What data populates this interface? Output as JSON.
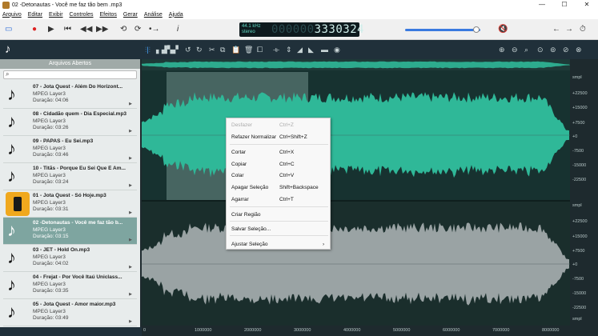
{
  "window": {
    "title": "02 -Detonautas - Você me faz tão bem .mp3",
    "min": "—",
    "max": "☐",
    "close": "✕"
  },
  "menu": [
    "Arquivo",
    "Editar",
    "Exibir",
    "Controles",
    "Efeitos",
    "Gerar",
    "Análise",
    "Ajuda"
  ],
  "display": {
    "khz": "44.1 kHz",
    "stereo": "stereo",
    "counter_dim": "000000",
    "counter_value": "3330324"
  },
  "volume": {
    "level": 0.95
  },
  "sidebar": {
    "header": "Arquivos Abertos",
    "search_placeholder": "",
    "items": [
      {
        "title": "07 - Jota Quest - Além Do Horizont...",
        "format": "MPEG Layer3",
        "duration": "Duração: 04:06",
        "icon": "music-note-icon"
      },
      {
        "title": "08 - Cidadão quem - Dia Especial.mp3",
        "format": "MPEG Layer3",
        "duration": "Duração: 03:26",
        "icon": "music-note-icon"
      },
      {
        "title": "09 - PAPAS - Eu Sei.mp3",
        "format": "MPEG Layer3",
        "duration": "Duração: 03:46",
        "icon": "music-note-icon"
      },
      {
        "title": "10 - Titãs - Porque Eu Sei Que É Am...",
        "format": "MPEG Layer3",
        "duration": "Duração: 03:24",
        "icon": "music-note-icon"
      },
      {
        "title": "01 - Jota Quest - Só Hoje.mp3",
        "format": "MPEG Layer3",
        "duration": "Duração: 03:31",
        "icon": "app-icon"
      },
      {
        "title": "02 -Detonautas - Você me faz tão b...",
        "format": "MPEG Layer3",
        "duration": "Duração: 03:15",
        "icon": "music-note-icon",
        "selected": true
      },
      {
        "title": "03 - JET - Hold On.mp3",
        "format": "MPEG Layer3",
        "duration": "Duração: 04:02",
        "icon": "music-note-icon"
      },
      {
        "title": "04 - Frejat - Por Você Itaú Uniclass...",
        "format": "MPEG Layer3",
        "duration": "Duração: 03:35",
        "icon": "music-note-icon"
      },
      {
        "title": "05 - Jota Quest - Amor maior.mp3",
        "format": "MPEG Layer3",
        "duration": "Duração: 03:49",
        "icon": "music-note-icon"
      }
    ]
  },
  "ruler": {
    "top": [
      "smpl",
      "+22500",
      "+15000",
      "+7500",
      "+0",
      "-7500",
      "-15000",
      "-22500"
    ],
    "bottom": [
      "smpl",
      "+22500",
      "+15000",
      "+7500",
      "+0",
      "-7500",
      "-15000",
      "-22500",
      "smpl"
    ]
  },
  "timeline": [
    "0",
    "1000000",
    "2000000",
    "3000000",
    "4000000",
    "5000000",
    "6000000",
    "7000000",
    "8000000"
  ],
  "context_menu": {
    "items": [
      {
        "label": "Desfazer",
        "shortcut": "Ctrl+Z",
        "disabled": true
      },
      {
        "label": "Refazer Normalizar",
        "shortcut": "Ctrl+Shift+Z"
      },
      {
        "label": "Cortar",
        "shortcut": "Ctrl+X"
      },
      {
        "label": "Copiar",
        "shortcut": "Ctrl+C"
      },
      {
        "label": "Colar",
        "shortcut": "Ctrl+V"
      },
      {
        "label": "Apagar Seleção",
        "shortcut": "Shift+Backspace"
      },
      {
        "label": "Agarrar",
        "shortcut": "Ctrl+T"
      },
      {
        "label": "Criar Região",
        "shortcut": ""
      },
      {
        "label": "Salvar Seleção...",
        "shortcut": ""
      },
      {
        "label": "Ajustar Seleção",
        "shortcut": "›"
      }
    ]
  },
  "colors": {
    "wave_top": "#2fb898",
    "wave_bottom": "#9aa3a4",
    "selection": "#6f8f8a"
  }
}
